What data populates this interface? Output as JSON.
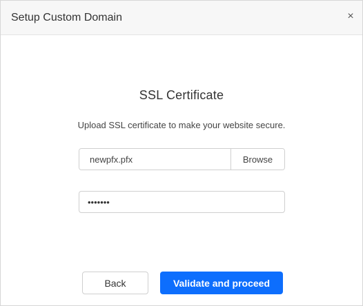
{
  "dialog": {
    "title": "Setup Custom Domain",
    "close_glyph": "×"
  },
  "section": {
    "title": "SSL Certificate",
    "subtitle": "Upload SSL certificate to make your website secure."
  },
  "file_field": {
    "value": "newpfx.pfx",
    "browse_label": "Browse"
  },
  "password_field": {
    "value": "•••••••"
  },
  "actions": {
    "back_label": "Back",
    "proceed_label": "Validate and proceed"
  },
  "colors": {
    "primary": "#0d6efd",
    "header_bg": "#f7f7f7",
    "border": "#cfcfcf"
  }
}
